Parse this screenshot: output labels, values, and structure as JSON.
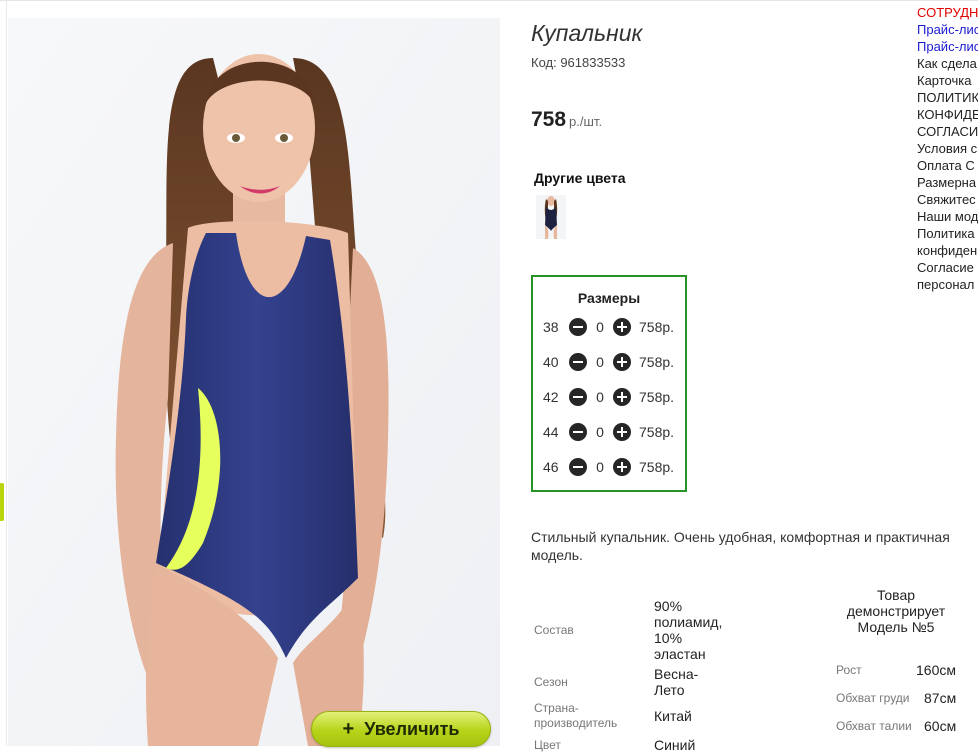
{
  "product": {
    "title": "Купальник",
    "code": "Код: 961833533",
    "price": "758",
    "price_unit": "р./шт.",
    "zoom_label": "Увеличить",
    "other_colors_title": "Другие цвета",
    "description": "Стильный купальник. Очень удобная, комфортная и практичная модель."
  },
  "sizes": {
    "title": "Размеры",
    "rows": [
      {
        "size": "38",
        "qty": "0",
        "price": "758р."
      },
      {
        "size": "40",
        "qty": "0",
        "price": "758р."
      },
      {
        "size": "42",
        "qty": "0",
        "price": "758р."
      },
      {
        "size": "44",
        "qty": "0",
        "price": "758р."
      },
      {
        "size": "46",
        "qty": "0",
        "price": "758р."
      }
    ]
  },
  "specs": [
    {
      "label": "Состав",
      "value": "90% полиамид, 10% эластан"
    },
    {
      "label": "Сезон",
      "value": "Весна-Лето"
    },
    {
      "label": "Страна-производитель",
      "value": "Китай"
    },
    {
      "label": "Цвет",
      "value": "Синий"
    }
  ],
  "model": {
    "header": "Товар демонстрирует Модель №5",
    "params": [
      {
        "label": "Рост",
        "value": "160см"
      },
      {
        "label": "Обхват груди",
        "value": "87см"
      },
      {
        "label": "Обхват талии",
        "value": "60см"
      }
    ]
  },
  "right_nav": [
    {
      "text": "СОТРУДН",
      "color": "#e00000"
    },
    {
      "text": "Прайс-лис",
      "color": "#1b1bd1"
    },
    {
      "text": "Прайс-лис",
      "color": "#1b1bd1"
    },
    {
      "text": "Как сдела",
      "color": "#222222"
    },
    {
      "text": "Карточка",
      "color": "#222222"
    },
    {
      "text": "ПОЛИТИК",
      "color": "#222222"
    },
    {
      "text": "КОНФИДЕ",
      "color": "#222222"
    },
    {
      "text": "СОГЛАСИ",
      "color": "#222222"
    },
    {
      "text": "Условия с",
      "color": "#222222"
    },
    {
      "text": "Оплата С",
      "color": "#222222"
    },
    {
      "text": "Размерна",
      "color": "#222222"
    },
    {
      "text": "Свяжитес",
      "color": "#222222"
    },
    {
      "text": "Наши мод",
      "color": "#222222"
    },
    {
      "text": "Политика",
      "color": "#222222"
    },
    {
      "text": "конфиден",
      "color": "#222222"
    },
    {
      "text": "Согласие",
      "color": "#222222"
    },
    {
      "text": "персонал",
      "color": "#222222"
    }
  ],
  "colors": {
    "sizes_border": "#2a9127",
    "zoom_button": "#b7d319",
    "swimsuit": "#2f3d86",
    "accent_stripe": "#e6ff5c"
  }
}
